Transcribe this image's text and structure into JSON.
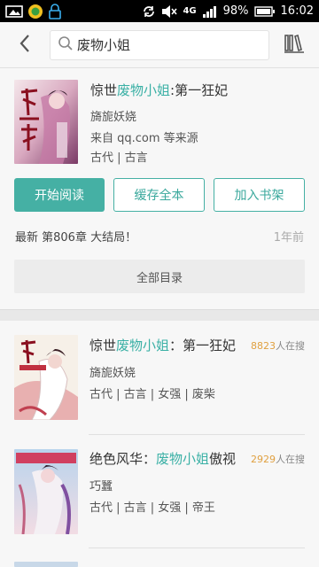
{
  "status_bar": {
    "battery": "98%",
    "time": "16:02",
    "network": "4G"
  },
  "header": {
    "search_query": "废物小姐"
  },
  "main_result": {
    "title_prefix": "惊世",
    "title_highlight": "废物小姐",
    "title_suffix": ":第一狂妃",
    "author": "旖旎妖娆",
    "source": "来自 qq.com 等来源",
    "tags": "古代 | 古言",
    "buttons": {
      "read": "开始阅读",
      "cache": "缓存全本",
      "add_shelf": "加入书架"
    },
    "latest_chapter": "最新  第806章 大结局！",
    "updated": "1年前",
    "toc_label": "全部目录"
  },
  "results": [
    {
      "title_prefix": "惊世",
      "title_highlight": "废物小姐",
      "title_suffix": "：第一狂妃",
      "author": "旖旎妖娆",
      "tags": "古代 | 古言 | 女强 | 废柴",
      "readers_count": "8823",
      "readers_suffix": "人在搜"
    },
    {
      "title_prefix": "绝色风华：",
      "title_highlight": "废物小姐",
      "title_suffix": "傲视",
      "author": "巧蠶",
      "tags": "古代 | 古言 | 女强 | 帝王",
      "readers_count": "2929",
      "readers_suffix": "人在搜"
    }
  ],
  "colors": {
    "accent": "#45b0a4",
    "highlight": "#3ab0a5",
    "readers_count": "#e0a040"
  }
}
